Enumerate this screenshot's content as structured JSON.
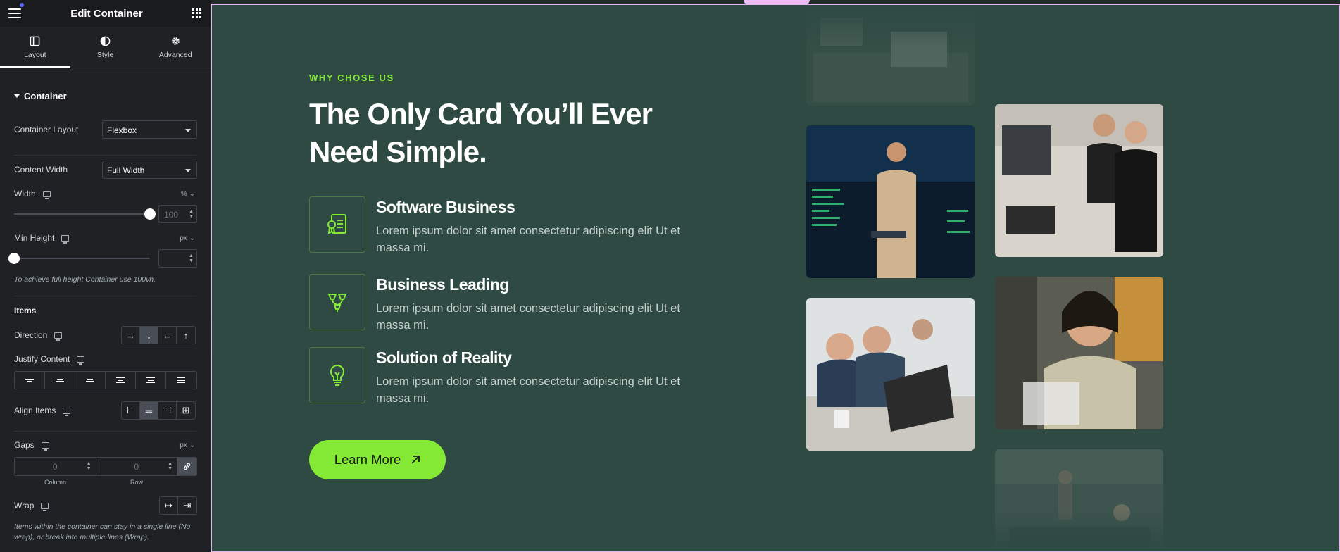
{
  "panel": {
    "header": {
      "title": "Edit Container"
    },
    "tabs": [
      {
        "label": "Layout",
        "icon": "layout-icon"
      },
      {
        "label": "Style",
        "icon": "contrast-icon"
      },
      {
        "label": "Advanced",
        "icon": "gear-icon"
      }
    ],
    "section": "Container",
    "container_layout": {
      "label": "Container Layout",
      "value": "Flexbox"
    },
    "content_width": {
      "label": "Content Width",
      "value": "Full Width"
    },
    "width": {
      "label": "Width",
      "unit": "%",
      "value": "100",
      "slider_fraction": 1.0
    },
    "min_height": {
      "label": "Min Height",
      "unit": "px",
      "value": "",
      "slider_fraction": 0
    },
    "min_height_hint": "To achieve full height Container use 100vh.",
    "items_heading": "Items",
    "direction": {
      "label": "Direction",
      "active": "column"
    },
    "justify_content": {
      "label": "Justify Content"
    },
    "align_items": {
      "label": "Align Items",
      "active": "center"
    },
    "gaps": {
      "label": "Gaps",
      "unit": "px",
      "column": "0",
      "row": "0",
      "column_label": "Column",
      "row_label": "Row"
    },
    "wrap": {
      "label": "Wrap"
    },
    "wrap_hint": "Items within the container can stay in a single line (No wrap), or break into multiple lines (Wrap)."
  },
  "page": {
    "eyebrow": "WHY CHOSE US",
    "heading": "The Only Card You’ll Ever Need Simple.",
    "features": [
      {
        "title": "Software Business",
        "desc": "Lorem ipsum dolor sit amet consectetur adipiscing elit Ut et massa mi.",
        "icon": "certificate-icon"
      },
      {
        "title": "Business Leading",
        "desc": "Lorem ipsum dolor sit amet consectetur adipiscing elit Ut et massa mi.",
        "icon": "funnel-icon"
      },
      {
        "title": "Solution of Reality",
        "desc": "Lorem ipsum dolor sit amet consectetur adipiscing elit Ut et massa mi.",
        "icon": "lightbulb-icon"
      }
    ],
    "cta": "Learn More",
    "colors": {
      "bg": "#2e4a43",
      "accent": "#84ea36",
      "panel": "#1f2124"
    }
  }
}
